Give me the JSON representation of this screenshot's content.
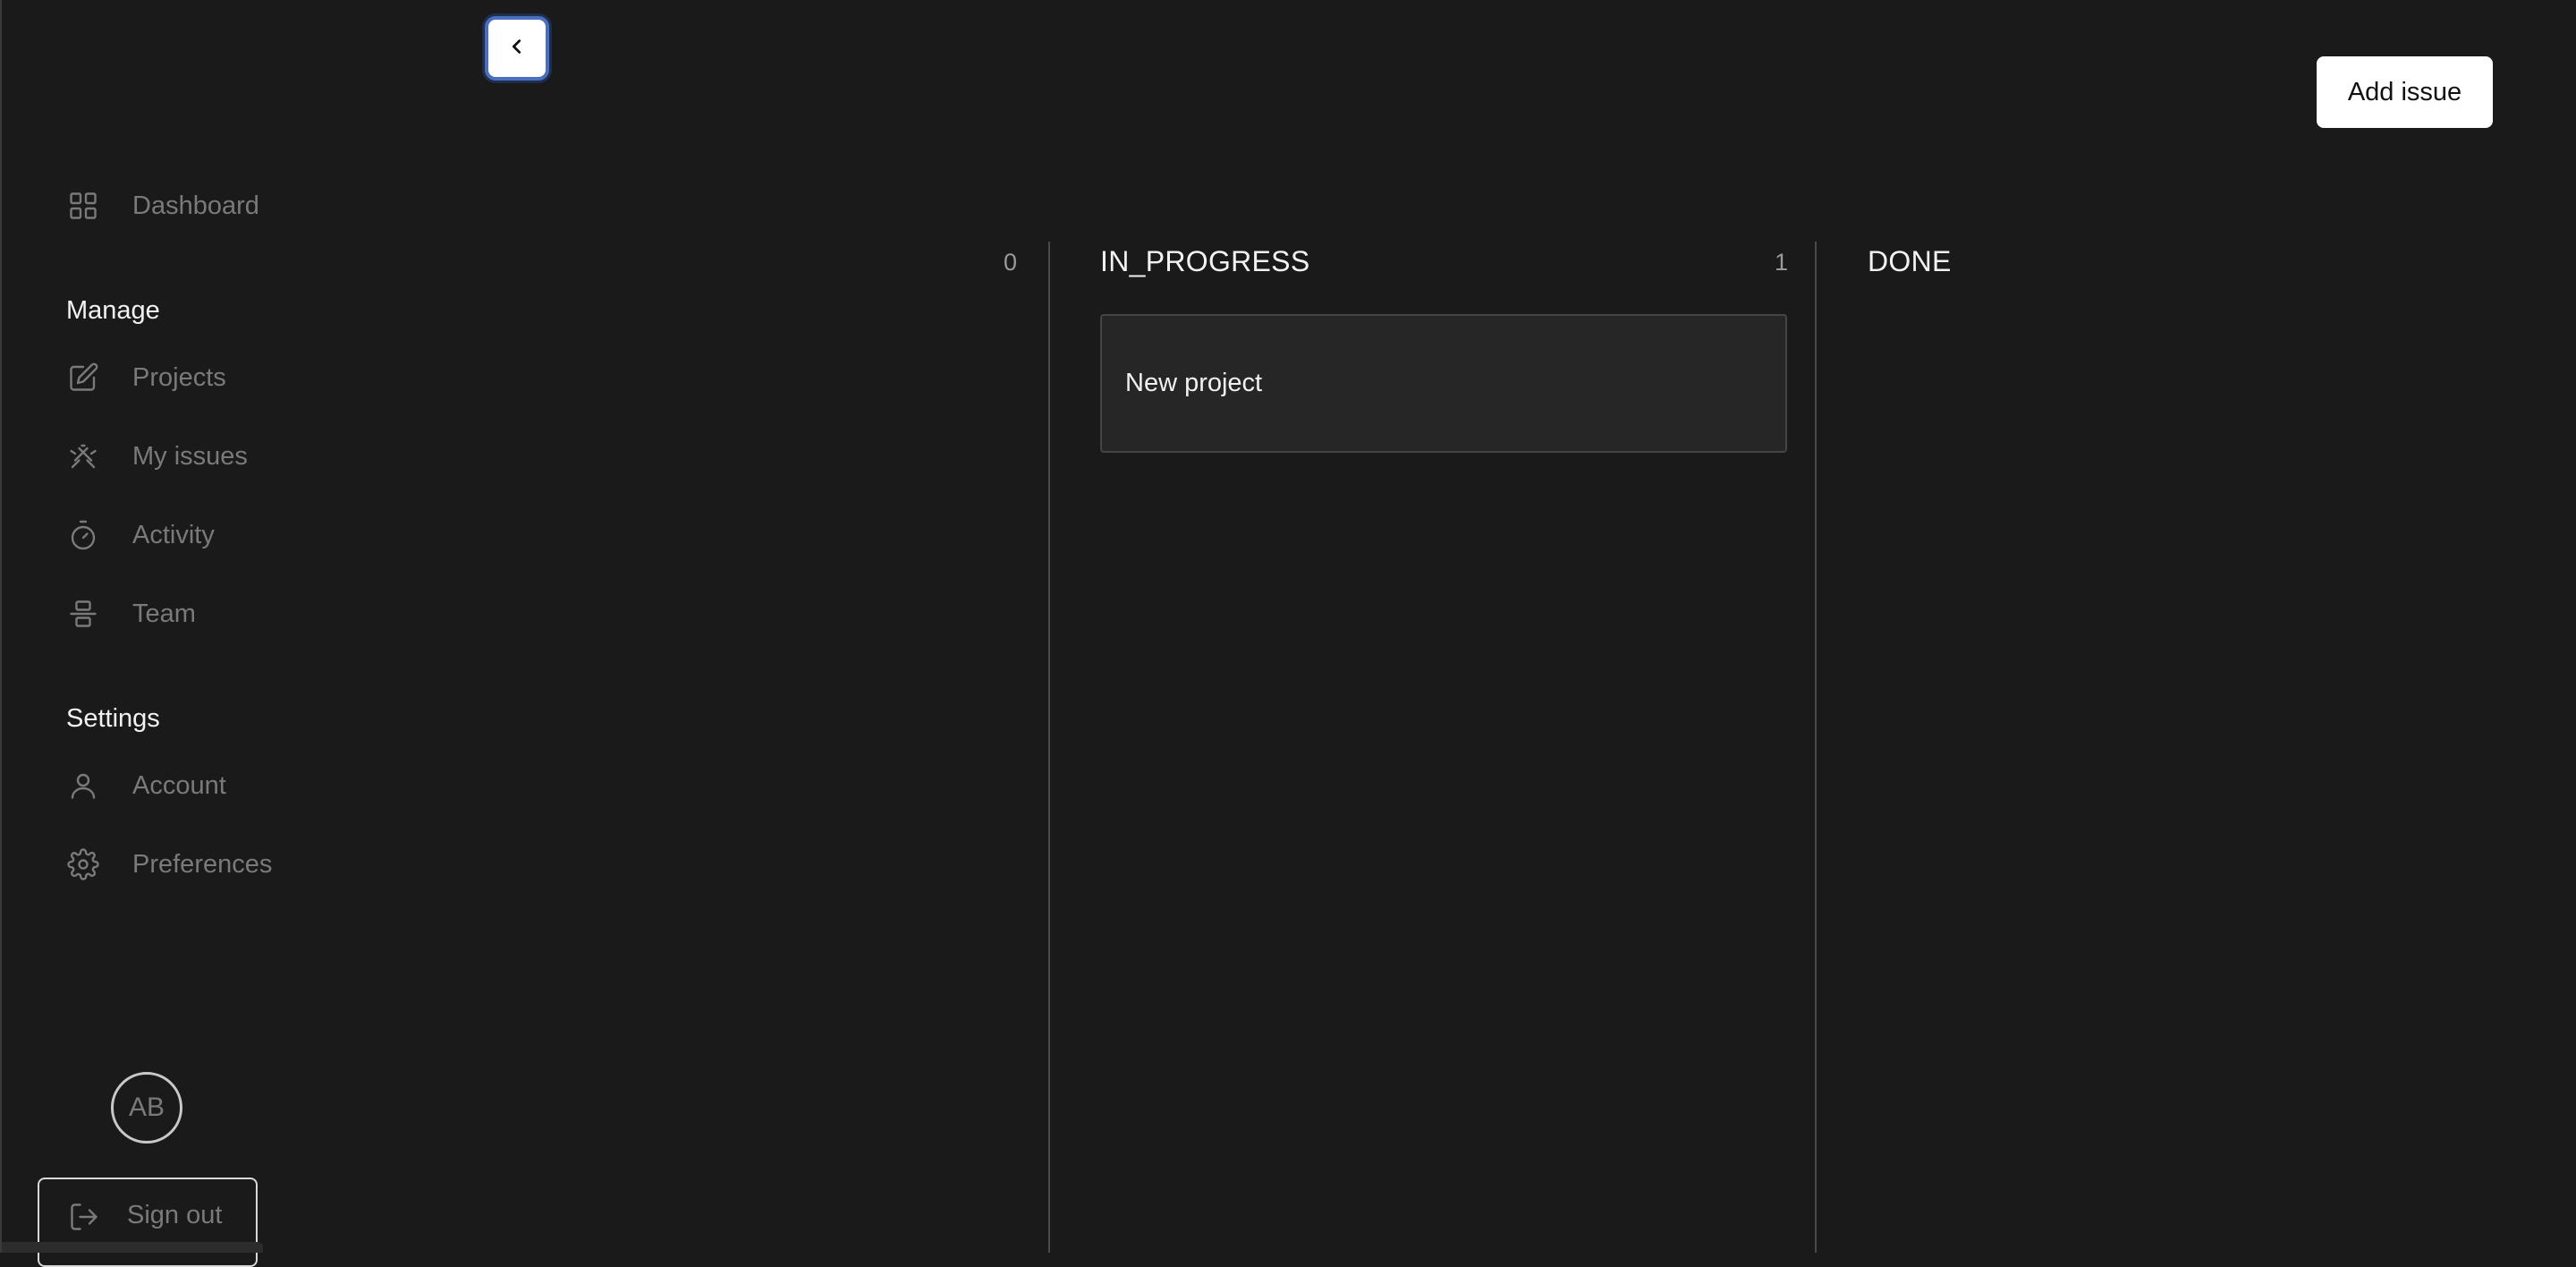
{
  "sidebar": {
    "nav": [
      {
        "label": "Dashboard",
        "icon": "grid-icon"
      }
    ],
    "manage": {
      "title": "Manage",
      "items": [
        {
          "label": "Projects",
          "icon": "edit-icon"
        },
        {
          "label": "My issues",
          "icon": "bug-icon"
        },
        {
          "label": "Activity",
          "icon": "timer-icon"
        },
        {
          "label": "Team",
          "icon": "team-icon"
        }
      ]
    },
    "settings": {
      "title": "Settings",
      "items": [
        {
          "label": "Account",
          "icon": "user-icon"
        },
        {
          "label": "Preferences",
          "icon": "gear-icon"
        }
      ]
    },
    "user": {
      "initials": "AB"
    },
    "sign_out_label": "Sign out"
  },
  "header": {
    "add_issue_label": "Add issue"
  },
  "board": {
    "columns": [
      {
        "title": "",
        "count": "0",
        "cards": []
      },
      {
        "title": "IN_PROGRESS",
        "count": "1",
        "cards": [
          {
            "title": "New project"
          }
        ]
      },
      {
        "title": "DONE",
        "count": "",
        "cards": []
      }
    ]
  }
}
